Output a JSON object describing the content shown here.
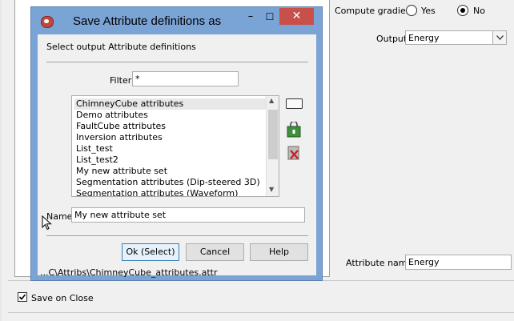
{
  "background": {
    "compute_gradient_label": "Compute gradient",
    "radio_yes_label": "Yes",
    "radio_no_label": "No",
    "output_label": "Output",
    "output_value": "Energy",
    "attribute_name_label": "Attribute name",
    "attribute_name_value": "Energy",
    "save_on_close_label": "Save on Close",
    "save_on_close_checked": true
  },
  "dialog": {
    "title": "Save Attribute definitions as",
    "minimize_glyph": "–",
    "maximize_glyph": "☐",
    "close_glyph": "✕",
    "heading": "Select output Attribute definitions",
    "filter_label": "Filter",
    "filter_value": "*",
    "list_items": [
      "ChimneyCube attributes",
      "Demo attributes",
      "FaultCube attributes",
      "Inversion attributes",
      "List_test",
      "List_test2",
      "My new attribute set",
      "Segmentation attributes (Dip-steered 3D)",
      "Segmentation attributes (Waveform)"
    ],
    "selected_index": 0,
    "name_label": "Name",
    "name_value": "My new attribute set",
    "ok_label": "Ok (Select)",
    "cancel_label": "Cancel",
    "help_label": "Help",
    "path": "...C\\Attribs\\ChimneyCube_attributes.attr",
    "scroll_up_glyph": "▲",
    "scroll_down_glyph": "▼"
  }
}
